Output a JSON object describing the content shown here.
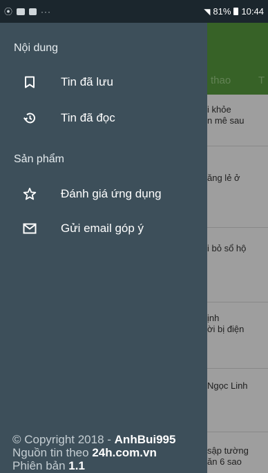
{
  "status_bar": {
    "dots": "···",
    "signal": "∷.∣",
    "battery_percent": "81%",
    "time": "10:44"
  },
  "background": {
    "tabs": [
      "thao",
      "T"
    ],
    "items": [
      {
        "line1": "i khỏe",
        "line2": "n mê sau"
      },
      {
        "line1": "ăng lẻ ở",
        "line2": ""
      },
      {
        "line1": "i bỏ sổ hộ",
        "line2": ""
      },
      {
        "line1": "ịnh",
        "line2": "ời bị điện"
      },
      {
        "line1": "Ngọc Linh",
        "line2": ""
      },
      {
        "line1": "sập tường",
        "line2": "ăn 6 sao"
      }
    ]
  },
  "drawer": {
    "section_content": "Nội dung",
    "saved_label": "Tin đã lưu",
    "read_label": "Tin đã đọc",
    "section_products": "Sản phẩm",
    "rate_label": "Đánh giá ứng dụng",
    "email_label": "Gửi email góp ý",
    "copyright_prefix": "© Copyright 2018 - ",
    "copyright_author": "AnhBui995",
    "source_prefix": "Nguồn tin theo ",
    "source_site": "24h.com.vn",
    "version_prefix": "Phiên bản ",
    "version": "1.1"
  },
  "icons": {
    "saved": "bookmark-icon",
    "read": "history-icon",
    "rate": "star-icon",
    "email": "mail-icon"
  },
  "colors": {
    "drawer_bg": "#3d4f5a",
    "app_green": "#5a9e3f",
    "status_bar": "#1b262d"
  }
}
